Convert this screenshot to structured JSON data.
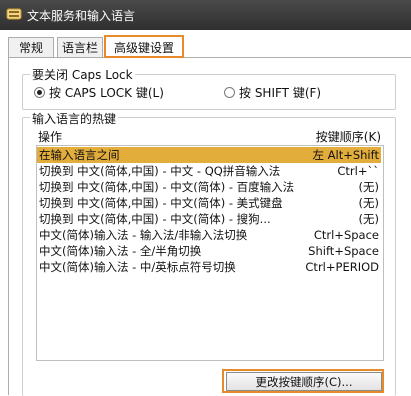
{
  "window": {
    "title": "文本服务和输入语言"
  },
  "tabs": [
    {
      "label": "常规"
    },
    {
      "label": "语言栏"
    },
    {
      "label": "高级键设置"
    }
  ],
  "caps_lock": {
    "group_title": "要关闭 Caps Lock",
    "options": [
      {
        "label": "按 CAPS LOCK 键(L)",
        "selected": true
      },
      {
        "label": "按 SHIFT 键(F)",
        "selected": false
      }
    ]
  },
  "hotkeys": {
    "group_title": "输入语言的热键",
    "col_action": "操作",
    "col_key": "按键顺序(K)",
    "rows": [
      {
        "action": "在输入语言之间",
        "key": "左 Alt+Shift",
        "selected": true
      },
      {
        "action": "切换到 中文(简体,中国) - 中文 - QQ拼音输入法",
        "key": "Ctrl+`` ",
        "selected": false
      },
      {
        "action": "切换到 中文(简体,中国) - 中文(简体) - 百度输入法",
        "key": "(无)",
        "selected": false
      },
      {
        "action": "切换到 中文(简体,中国) - 中文(简体) - 美式键盘",
        "key": "(无)",
        "selected": false
      },
      {
        "action": "切换到 中文(简体,中国) - 中文(简体) - 搜狗...",
        "key": "(无)",
        "selected": false
      },
      {
        "action": "中文(简体)输入法 - 输入法/非输入法切换",
        "key": "Ctrl+Space",
        "selected": false
      },
      {
        "action": "中文(简体)输入法 - 全/半角切换",
        "key": "Shift+Space",
        "selected": false
      },
      {
        "action": "中文(简体)输入法 - 中/英标点符号切换",
        "key": "Ctrl+PERIOD",
        "selected": false
      }
    ],
    "change_button": "更改按键顺序(C)..."
  },
  "colors": {
    "accent_outline": "#e8892c",
    "selection": "#e3ad3c",
    "titlebar": "#3a3a3a"
  }
}
